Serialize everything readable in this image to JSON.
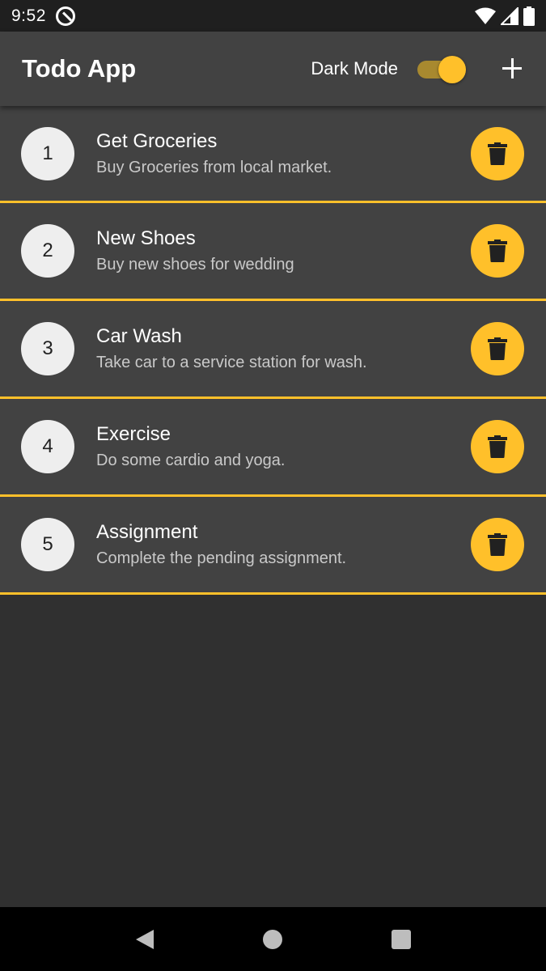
{
  "status_bar": {
    "time": "9:52",
    "icons": [
      "app-notification-icon",
      "wifi-icon",
      "cell-signal-icon",
      "battery-icon"
    ]
  },
  "app_bar": {
    "title": "Todo App",
    "dark_mode_label": "Dark Mode",
    "dark_mode_on": true,
    "add_icon": "plus-icon"
  },
  "todos": [
    {
      "index": "1",
      "title": "Get Groceries",
      "subtitle": "Buy Groceries from local market."
    },
    {
      "index": "2",
      "title": "New Shoes",
      "subtitle": "Buy new shoes for wedding"
    },
    {
      "index": "3",
      "title": "Car Wash",
      "subtitle": "Take car to a service station for wash."
    },
    {
      "index": "4",
      "title": "Exercise",
      "subtitle": "Do some cardio and yoga."
    },
    {
      "index": "5",
      "title": "Assignment",
      "subtitle": "Complete the pending assignment."
    }
  ],
  "colors": {
    "accent": "#ffc02a",
    "background": "#303030",
    "surface": "#424242"
  },
  "nav_bar": {
    "icons": [
      "back-icon",
      "home-icon",
      "recents-icon"
    ]
  }
}
